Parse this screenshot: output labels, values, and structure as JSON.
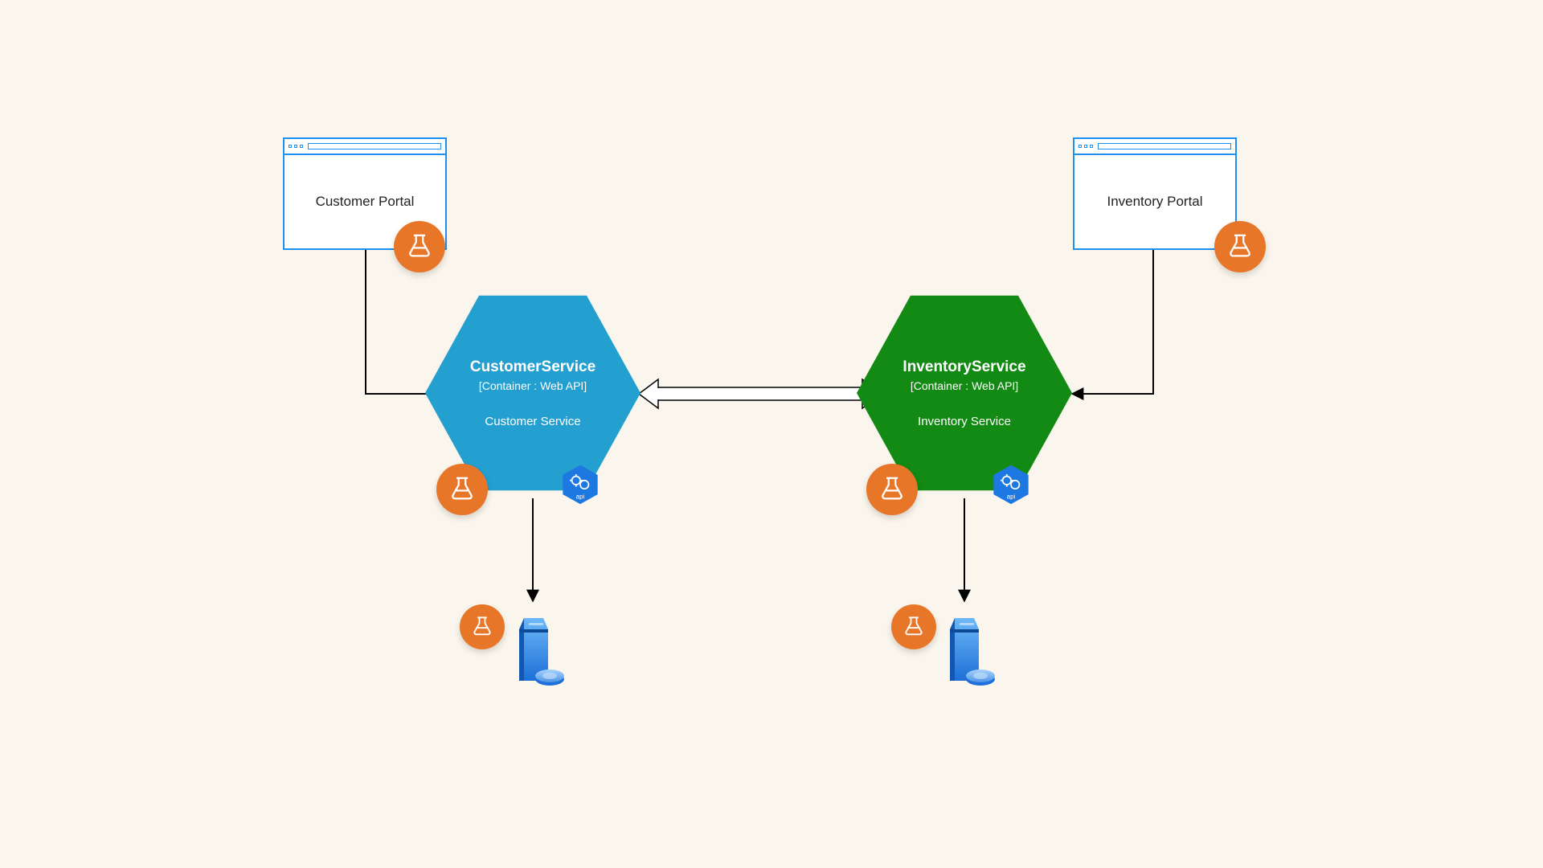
{
  "portals": {
    "customer": {
      "label": "Customer Portal"
    },
    "inventory": {
      "label": "Inventory Portal"
    }
  },
  "services": {
    "customer": {
      "title": "CustomerService",
      "subtitle": "[Container : Web API]",
      "desc": "Customer Service"
    },
    "inventory": {
      "title": "InventoryService",
      "subtitle": "[Container : Web API]",
      "desc": "Inventory Service"
    }
  },
  "badges": {
    "api_label": "api"
  },
  "colors": {
    "browser_border": "#1e90f0",
    "hex_blue": "#239fd0",
    "hex_green": "#138a13",
    "beaker": "#e87629",
    "api_hex": "#1e78e2"
  }
}
